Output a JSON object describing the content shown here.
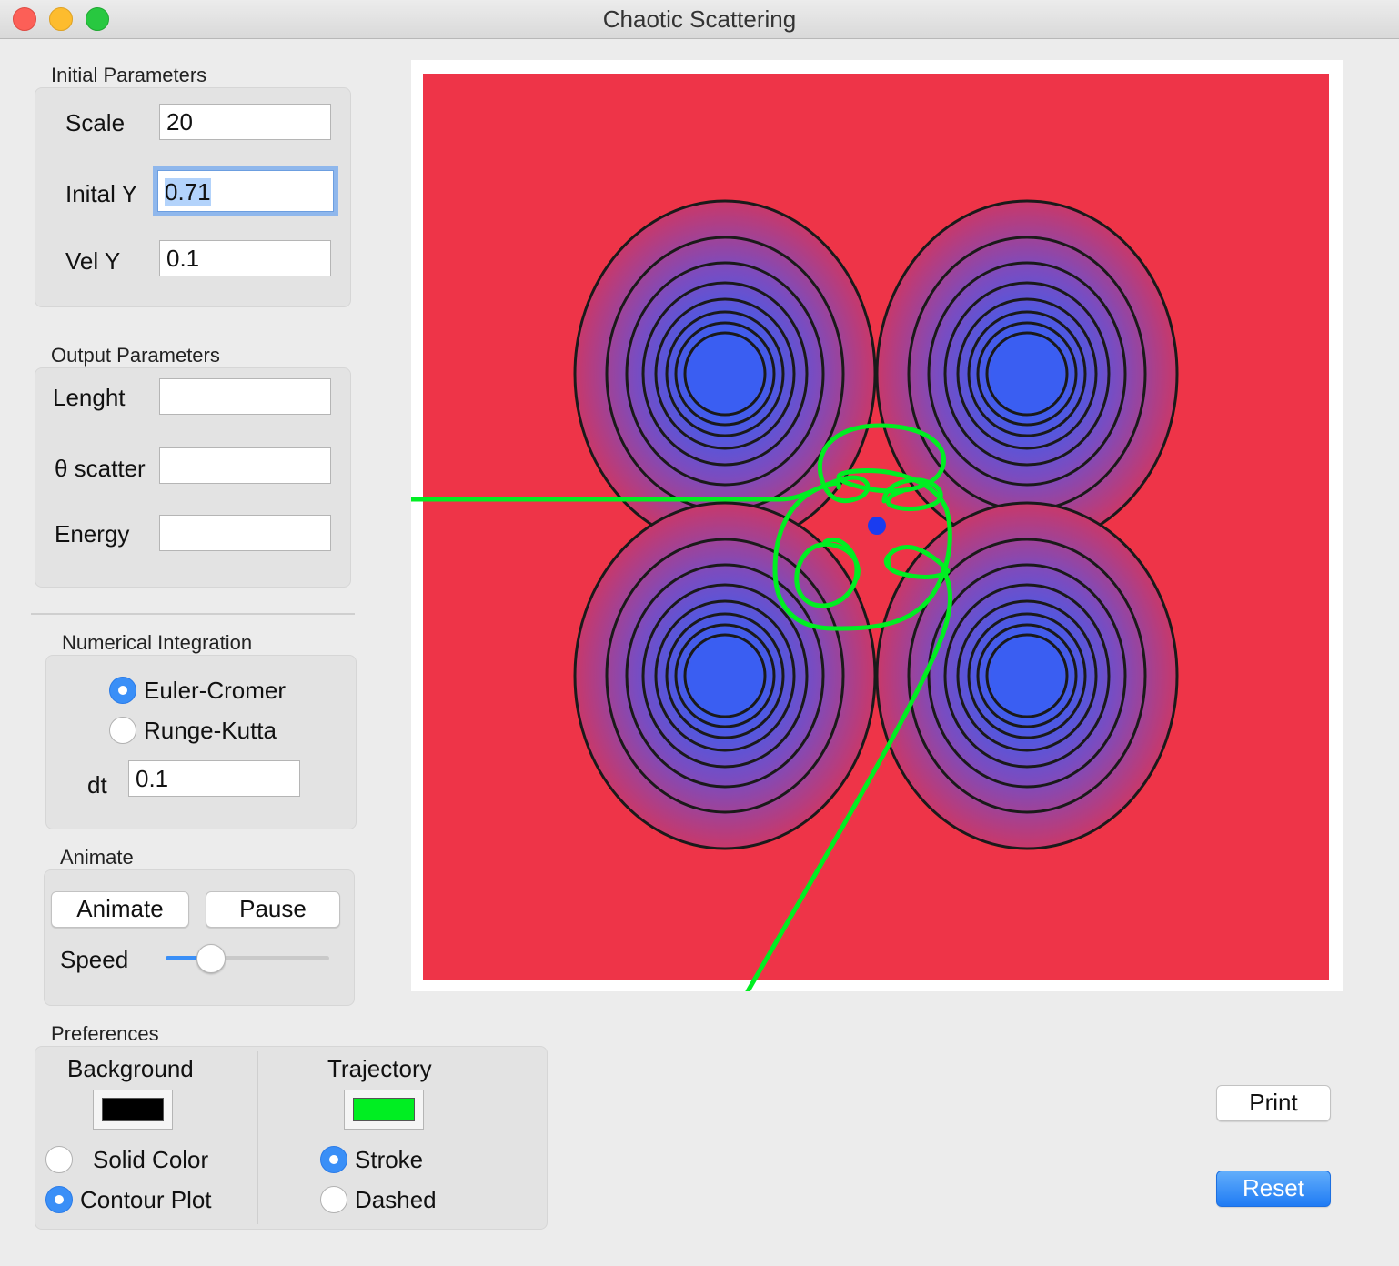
{
  "window": {
    "title": "Chaotic Scattering"
  },
  "initial_parameters": {
    "title": "Initial Parameters",
    "scale_label": "Scale",
    "scale_value": "20",
    "initial_y_label": "Inital Y",
    "initial_y_value": "0.71",
    "vel_y_label": "Vel Y",
    "vel_y_value": "0.1"
  },
  "output_parameters": {
    "title": "Output Parameters",
    "length_label": "Lenght",
    "length_value": "",
    "theta_label": "θ scatter",
    "theta_value": "",
    "energy_label": "Energy",
    "energy_value": ""
  },
  "numerical_integration": {
    "title": "Numerical Integration",
    "euler_label": "Euler-Cromer",
    "euler_selected": true,
    "runge_label": "Runge-Kutta",
    "runge_selected": false,
    "dt_label": "dt",
    "dt_value": "0.1"
  },
  "animate": {
    "title": "Animate",
    "animate_label": "Animate",
    "pause_label": "Pause",
    "speed_label": "Speed",
    "speed_fraction": 0.23
  },
  "preferences": {
    "title": "Preferences",
    "background_label": "Background",
    "background_color": "#000000",
    "solid_label": "Solid Color",
    "solid_selected": false,
    "contour_label": "Contour Plot",
    "contour_selected": true,
    "trajectory_label": "Trajectory",
    "trajectory_color": "#00ee22",
    "stroke_label": "Stroke",
    "stroke_selected": true,
    "dashed_label": "Dashed",
    "dashed_selected": false
  },
  "actions": {
    "print_label": "Print",
    "reset_label": "Reset"
  },
  "plot": {
    "background_color": "#ee3448",
    "well_color": "#3a5ef2",
    "trajectory_color": "#00ee22",
    "particle_color": "#1a3cf0",
    "contour_line_color": "#1a1a1a"
  }
}
